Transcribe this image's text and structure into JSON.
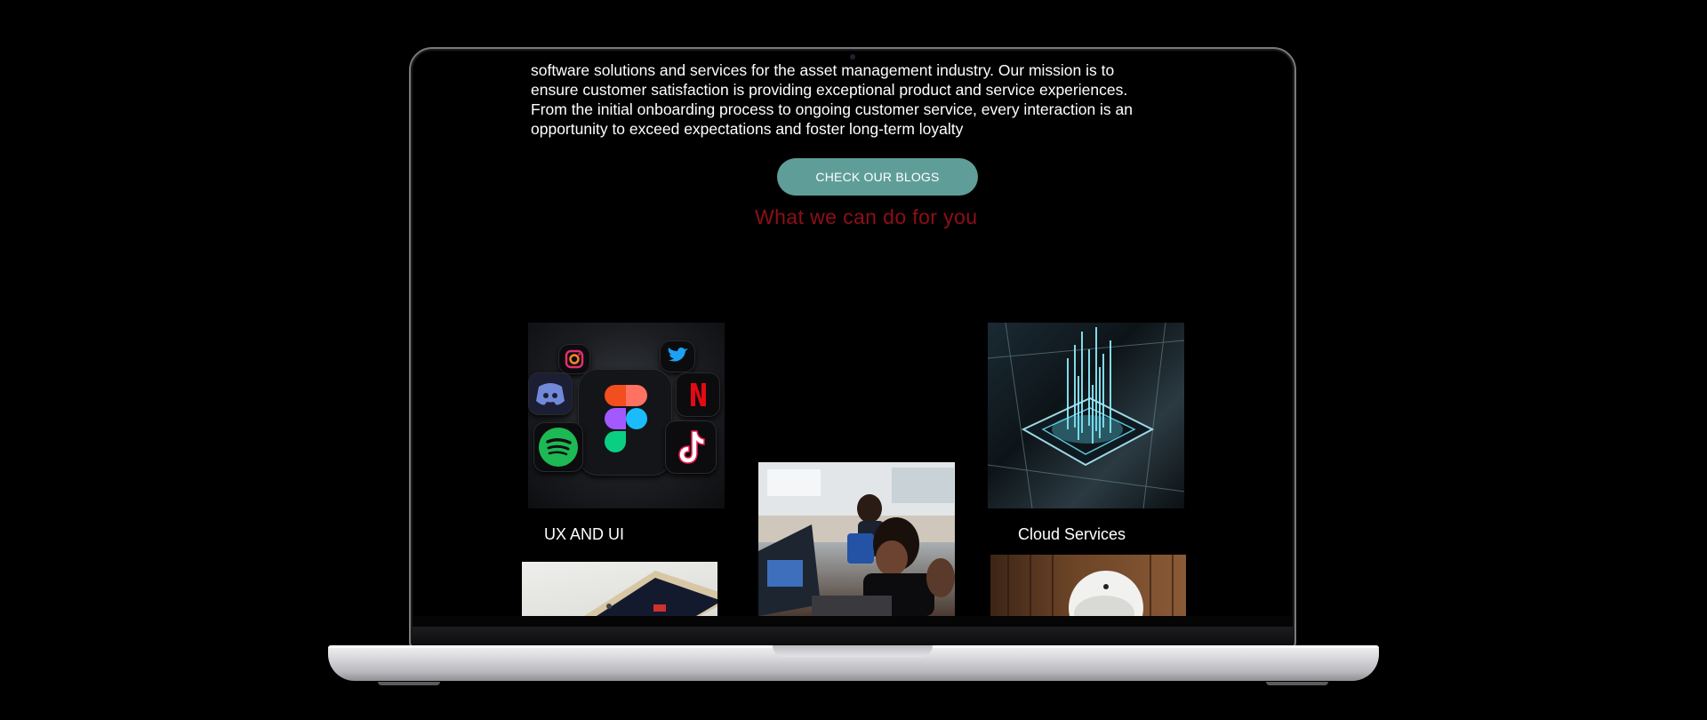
{
  "intro": {
    "lines": [
      "software solutions and services for the asset management industry. Our mission is to",
      "ensure customer satisfaction is providing exceptional product and service experiences.",
      "From the initial onboarding process to ongoing customer service, every interaction is an",
      "opportunity to exceed expectations and foster long-term loyalty"
    ]
  },
  "cta": {
    "label": "CHECK OUR  BLOGS"
  },
  "services": {
    "title": "What we can do for you",
    "cards": [
      {
        "label": "UX AND UI",
        "image": "app-icons-3d-image"
      },
      {
        "label": "",
        "image": "team-working-at-computers-image"
      },
      {
        "label": "Cloud Services",
        "image": "glowing-cpu-chip-image"
      },
      {
        "label": "",
        "image": "smartphone-image"
      },
      {
        "label": "",
        "image": "robot-image"
      }
    ]
  },
  "icons": [
    "instagram-icon",
    "twitter-icon",
    "discord-icon",
    "netflix-icon",
    "figma-icon",
    "spotify-icon",
    "tiktok-icon"
  ],
  "colors": {
    "button": "#5f9e98",
    "section_title": "#8e0f18",
    "background": "#000000",
    "text": "#ffffff"
  }
}
